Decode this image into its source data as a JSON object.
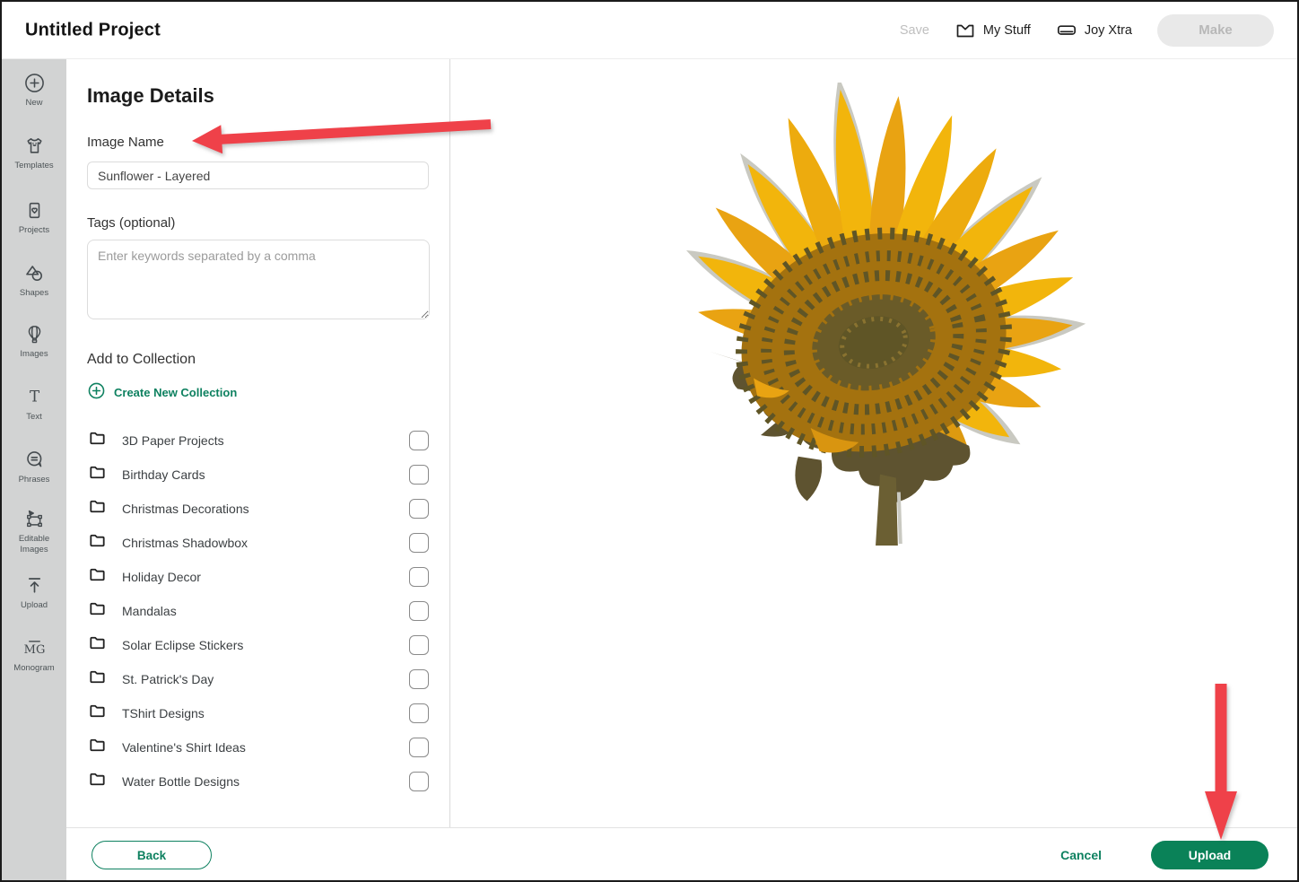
{
  "header": {
    "title": "Untitled Project",
    "save_label": "Save",
    "my_stuff_label": "My Stuff",
    "machine_label": "Joy Xtra",
    "make_label": "Make"
  },
  "sidebar": {
    "items": [
      {
        "label": "New",
        "icon": "plus-circle-icon"
      },
      {
        "label": "Templates",
        "icon": "tshirt-icon"
      },
      {
        "label": "Projects",
        "icon": "project-card-icon"
      },
      {
        "label": "Shapes",
        "icon": "shapes-icon"
      },
      {
        "label": "Images",
        "icon": "hot-air-balloon-icon"
      },
      {
        "label": "Text",
        "icon": "letter-t-icon"
      },
      {
        "label": "Phrases",
        "icon": "speech-bubble-icon"
      },
      {
        "label": "Editable Images",
        "icon": "vector-nodes-icon"
      },
      {
        "label": "Upload",
        "icon": "upload-arrow-icon"
      },
      {
        "label": "Monogram",
        "icon": "monogram-icon"
      }
    ]
  },
  "panel": {
    "title": "Image Details",
    "image_name_label": "Image Name",
    "image_name_value": "Sunflower - Layered",
    "tags_label": "Tags (optional)",
    "tags_placeholder": "Enter keywords separated by a comma",
    "collection_heading": "Add to Collection",
    "create_collection_label": "Create New Collection"
  },
  "collections": {
    "items": [
      {
        "name": "3D Paper Projects",
        "checked": false
      },
      {
        "name": "Birthday Cards",
        "checked": false
      },
      {
        "name": "Christmas Decorations",
        "checked": false
      },
      {
        "name": "Christmas Shadowbox",
        "checked": false
      },
      {
        "name": "Holiday Decor",
        "checked": false
      },
      {
        "name": "Mandalas",
        "checked": false
      },
      {
        "name": "Solar Eclipse Stickers",
        "checked": false
      },
      {
        "name": "St. Patrick's Day",
        "checked": false
      },
      {
        "name": "TShirt Designs",
        "checked": false
      },
      {
        "name": "Valentine's Shirt Ideas",
        "checked": false
      },
      {
        "name": "Water Bottle Designs",
        "checked": false
      }
    ]
  },
  "footer": {
    "back_label": "Back",
    "cancel_label": "Cancel",
    "upload_label": "Upload"
  },
  "preview": {
    "description": "Layered sunflower graphic preview"
  },
  "colors": {
    "accent_green": "#0A8258",
    "link_green": "#0E8160",
    "arrow_red": "#EF4149",
    "sidebar_bg": "#D2D3D3",
    "disabled_text": "#BDBDBD",
    "petal_yellow": "#F2B50C",
    "petal_gold": "#E9A312",
    "disc_brown": "#A4720F",
    "disc_olive": "#5F5526"
  }
}
